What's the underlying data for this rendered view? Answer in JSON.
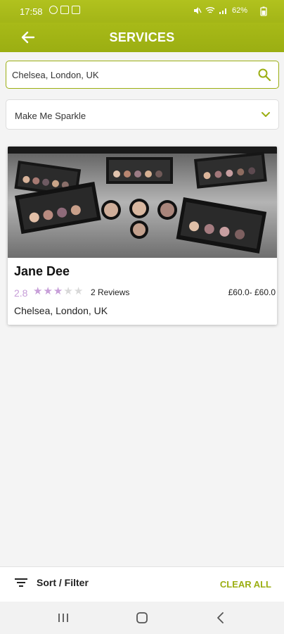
{
  "status_bar": {
    "time": "17:58",
    "battery": "62%"
  },
  "header": {
    "title": "SERVICES",
    "back_icon": "arrow-left-icon"
  },
  "search": {
    "value": "Chelsea, London, UK",
    "placeholder": "",
    "icon": "search-icon"
  },
  "category_select": {
    "selected": "Make Me Sparkle",
    "icon": "chevron-down-icon"
  },
  "results": [
    {
      "name": "Jane Dee",
      "rating": "2.8",
      "stars_filled": 3,
      "stars_total": 5,
      "reviews": "2 Reviews",
      "price": "£60.0- £60.0",
      "location": "Chelsea, London, UK",
      "image": "makeup-palettes-photo"
    }
  ],
  "filter_bar": {
    "sort_filter_label": "Sort / Filter",
    "clear_all_label": "CLEAR ALL"
  },
  "colors": {
    "brand": "#a3b517",
    "accent_text": "#9bae12",
    "rating": "#c79ed8"
  }
}
